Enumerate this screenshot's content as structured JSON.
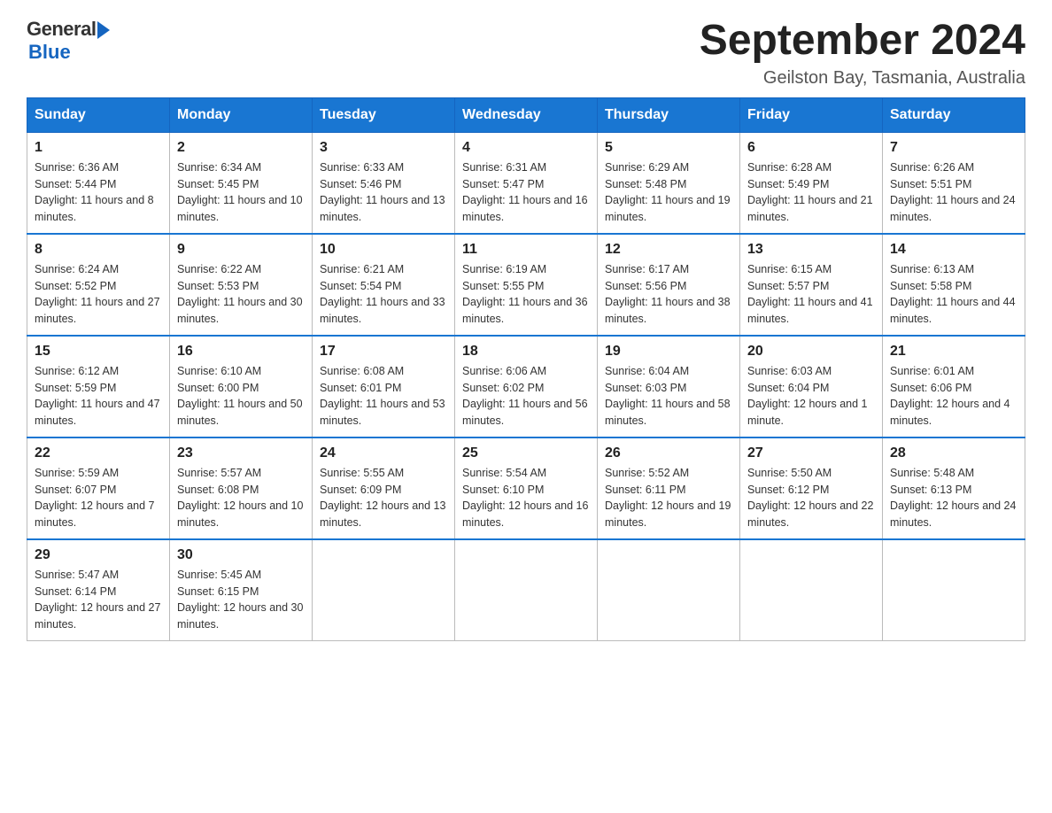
{
  "header": {
    "logo_general": "General",
    "logo_blue": "Blue",
    "title": "September 2024",
    "location": "Geilston Bay, Tasmania, Australia"
  },
  "days_of_week": [
    "Sunday",
    "Monday",
    "Tuesday",
    "Wednesday",
    "Thursday",
    "Friday",
    "Saturday"
  ],
  "weeks": [
    [
      {
        "day": 1,
        "sunrise": "6:36 AM",
        "sunset": "5:44 PM",
        "daylight": "11 hours and 8 minutes."
      },
      {
        "day": 2,
        "sunrise": "6:34 AM",
        "sunset": "5:45 PM",
        "daylight": "11 hours and 10 minutes."
      },
      {
        "day": 3,
        "sunrise": "6:33 AM",
        "sunset": "5:46 PM",
        "daylight": "11 hours and 13 minutes."
      },
      {
        "day": 4,
        "sunrise": "6:31 AM",
        "sunset": "5:47 PM",
        "daylight": "11 hours and 16 minutes."
      },
      {
        "day": 5,
        "sunrise": "6:29 AM",
        "sunset": "5:48 PM",
        "daylight": "11 hours and 19 minutes."
      },
      {
        "day": 6,
        "sunrise": "6:28 AM",
        "sunset": "5:49 PM",
        "daylight": "11 hours and 21 minutes."
      },
      {
        "day": 7,
        "sunrise": "6:26 AM",
        "sunset": "5:51 PM",
        "daylight": "11 hours and 24 minutes."
      }
    ],
    [
      {
        "day": 8,
        "sunrise": "6:24 AM",
        "sunset": "5:52 PM",
        "daylight": "11 hours and 27 minutes."
      },
      {
        "day": 9,
        "sunrise": "6:22 AM",
        "sunset": "5:53 PM",
        "daylight": "11 hours and 30 minutes."
      },
      {
        "day": 10,
        "sunrise": "6:21 AM",
        "sunset": "5:54 PM",
        "daylight": "11 hours and 33 minutes."
      },
      {
        "day": 11,
        "sunrise": "6:19 AM",
        "sunset": "5:55 PM",
        "daylight": "11 hours and 36 minutes."
      },
      {
        "day": 12,
        "sunrise": "6:17 AM",
        "sunset": "5:56 PM",
        "daylight": "11 hours and 38 minutes."
      },
      {
        "day": 13,
        "sunrise": "6:15 AM",
        "sunset": "5:57 PM",
        "daylight": "11 hours and 41 minutes."
      },
      {
        "day": 14,
        "sunrise": "6:13 AM",
        "sunset": "5:58 PM",
        "daylight": "11 hours and 44 minutes."
      }
    ],
    [
      {
        "day": 15,
        "sunrise": "6:12 AM",
        "sunset": "5:59 PM",
        "daylight": "11 hours and 47 minutes."
      },
      {
        "day": 16,
        "sunrise": "6:10 AM",
        "sunset": "6:00 PM",
        "daylight": "11 hours and 50 minutes."
      },
      {
        "day": 17,
        "sunrise": "6:08 AM",
        "sunset": "6:01 PM",
        "daylight": "11 hours and 53 minutes."
      },
      {
        "day": 18,
        "sunrise": "6:06 AM",
        "sunset": "6:02 PM",
        "daylight": "11 hours and 56 minutes."
      },
      {
        "day": 19,
        "sunrise": "6:04 AM",
        "sunset": "6:03 PM",
        "daylight": "11 hours and 58 minutes."
      },
      {
        "day": 20,
        "sunrise": "6:03 AM",
        "sunset": "6:04 PM",
        "daylight": "12 hours and 1 minute."
      },
      {
        "day": 21,
        "sunrise": "6:01 AM",
        "sunset": "6:06 PM",
        "daylight": "12 hours and 4 minutes."
      }
    ],
    [
      {
        "day": 22,
        "sunrise": "5:59 AM",
        "sunset": "6:07 PM",
        "daylight": "12 hours and 7 minutes."
      },
      {
        "day": 23,
        "sunrise": "5:57 AM",
        "sunset": "6:08 PM",
        "daylight": "12 hours and 10 minutes."
      },
      {
        "day": 24,
        "sunrise": "5:55 AM",
        "sunset": "6:09 PM",
        "daylight": "12 hours and 13 minutes."
      },
      {
        "day": 25,
        "sunrise": "5:54 AM",
        "sunset": "6:10 PM",
        "daylight": "12 hours and 16 minutes."
      },
      {
        "day": 26,
        "sunrise": "5:52 AM",
        "sunset": "6:11 PM",
        "daylight": "12 hours and 19 minutes."
      },
      {
        "day": 27,
        "sunrise": "5:50 AM",
        "sunset": "6:12 PM",
        "daylight": "12 hours and 22 minutes."
      },
      {
        "day": 28,
        "sunrise": "5:48 AM",
        "sunset": "6:13 PM",
        "daylight": "12 hours and 24 minutes."
      }
    ],
    [
      {
        "day": 29,
        "sunrise": "5:47 AM",
        "sunset": "6:14 PM",
        "daylight": "12 hours and 27 minutes."
      },
      {
        "day": 30,
        "sunrise": "5:45 AM",
        "sunset": "6:15 PM",
        "daylight": "12 hours and 30 minutes."
      },
      null,
      null,
      null,
      null,
      null
    ]
  ],
  "labels": {
    "sunrise": "Sunrise:",
    "sunset": "Sunset:",
    "daylight": "Daylight:"
  }
}
